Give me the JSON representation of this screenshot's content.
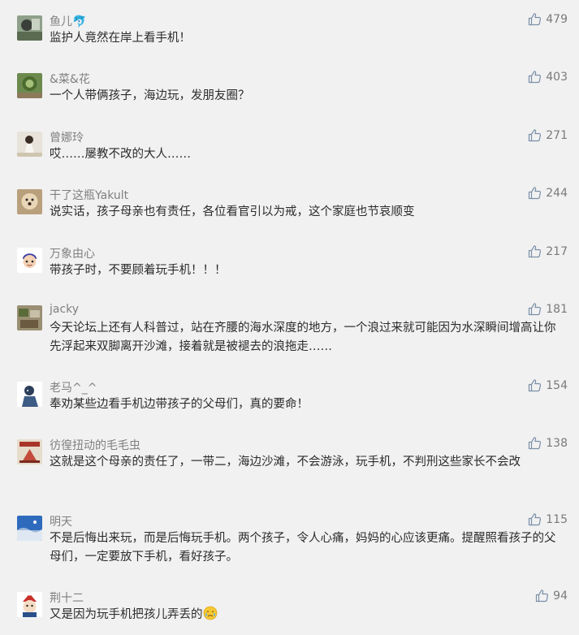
{
  "comments": [
    {
      "user": "鱼儿🐬",
      "text": "监护人竟然在岸上看手机！",
      "likes": "479"
    },
    {
      "user": "&菜&花",
      "text": "一个人带俩孩子，海边玩，发朋友圈？",
      "likes": "403"
    },
    {
      "user": "曾娜玲",
      "text": "哎……屡教不改的大人……",
      "likes": "271"
    },
    {
      "user": "干了这瓶Yakult",
      "text": "说实话，孩子母亲也有责任，各位看官引以为戒，这个家庭也节哀顺变",
      "likes": "244"
    },
    {
      "user": "万象由心",
      "text": "带孩子时，不要顾着玩手机！！！",
      "likes": "217"
    },
    {
      "user": "jacky",
      "text": "今天论坛上还有人科普过，站在齐腰的海水深度的地方，一个浪过来就可能因为水深瞬间增高让你先浮起来双脚离开沙滩，接着就是被褪去的浪拖走……",
      "likes": "181"
    },
    {
      "user": "老马^_^",
      "text": "奉劝某些边看手机边带孩子的父母们，真的要命！",
      "likes": "154"
    },
    {
      "user": "彷徨扭动的毛毛虫",
      "text": "这就是这个母亲的责任了，一带二，海边沙滩，不会游泳，玩手机，不判刑这些家长不会改",
      "likes": "138"
    },
    {
      "user": "明天",
      "text": "不是后悔出来玩，而是后悔玩手机。两个孩子，令人心痛，妈妈的心应该更痛。提醒照看孩子的父母们，一定要放下手机，看好孩子。",
      "likes": "115"
    },
    {
      "user": "荆十二",
      "text": "又是因为玩手机把孩儿弄丢的",
      "likes": "94"
    }
  ],
  "icons": {
    "like": "thumbs-up-icon",
    "emoji": "crying-face-emoji"
  },
  "colors": {
    "background": "#f1f1f1",
    "username": "#808080",
    "text": "#2b2b2b",
    "like": "#7a7a7a"
  }
}
